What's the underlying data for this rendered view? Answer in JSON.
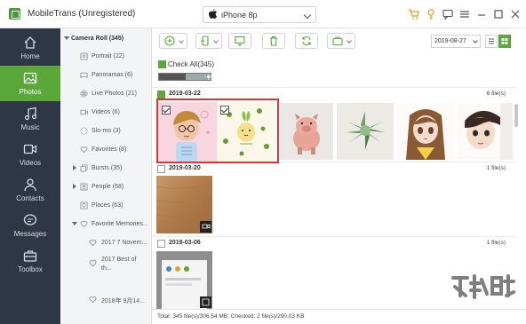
{
  "app": {
    "title": "MobileTrans (Unregistered)"
  },
  "device": {
    "name": "iPhone 8p"
  },
  "title_icons": [
    "cart-icon",
    "key-icon",
    "feedback-icon",
    "menu-icon",
    "minimize-icon",
    "maximize-icon",
    "close-icon"
  ],
  "nav": [
    {
      "label": "Home",
      "icon": "home-icon",
      "active": false
    },
    {
      "label": "Photos",
      "icon": "photos-icon",
      "active": true
    },
    {
      "label": "Music",
      "icon": "music-icon",
      "active": false
    },
    {
      "label": "Videos",
      "icon": "videos-icon",
      "active": false
    },
    {
      "label": "Contacts",
      "icon": "contacts-icon",
      "active": false
    },
    {
      "label": "Messages",
      "icon": "messages-icon",
      "active": false
    },
    {
      "label": "Toolbox",
      "icon": "toolbox-icon",
      "active": false
    }
  ],
  "tree": {
    "root": "Camera Roll (345)",
    "items": [
      {
        "label": "Portrait (22)",
        "icon": "portrait-icon"
      },
      {
        "label": "Panoramas (6)",
        "icon": "panorama-icon"
      },
      {
        "label": "Live Photos (21)",
        "icon": "live-photo-icon"
      },
      {
        "label": "Videos (6)",
        "icon": "video-icon"
      },
      {
        "label": "Slo-mo (3)",
        "icon": "slomo-icon"
      },
      {
        "label": "Favorites (8)",
        "icon": "heart-icon"
      },
      {
        "label": "Bursts (35)",
        "icon": "burst-icon"
      },
      {
        "label": "People (68)",
        "icon": "people-icon"
      },
      {
        "label": "Places (63)",
        "icon": "place-icon"
      },
      {
        "label": "Favorite Memories...",
        "icon": "heart-icon"
      },
      {
        "label": "2017 7 Novem...",
        "icon": "heart-icon"
      },
      {
        "label": "2017 Best of th...",
        "icon": "heart-icon"
      },
      {
        "label": "2018年 9月14...",
        "icon": "heart-icon"
      }
    ]
  },
  "toolbar": {
    "buttons": [
      "add-button",
      "export-to-device-button",
      "export-to-pc-button",
      "delete-button",
      "refresh-button",
      "more-button"
    ],
    "date": "2019-08-27"
  },
  "check_all": {
    "label": "Check All(345)"
  },
  "groups": [
    {
      "date": "2019-03-22",
      "count": "6 file(s)"
    },
    {
      "date": "2019-03-20",
      "count": "1 file(s)"
    },
    {
      "date": "2019-03-06",
      "count": "1 file(s)"
    }
  ],
  "status": {
    "text": "Total: 345 file(s)/306.54 MB; Checked: 2 file(s)/290.03 KB"
  },
  "colors": {
    "accent": "#5aa83a",
    "nav_bg": "#2f3646",
    "selection": "#d9353b"
  }
}
